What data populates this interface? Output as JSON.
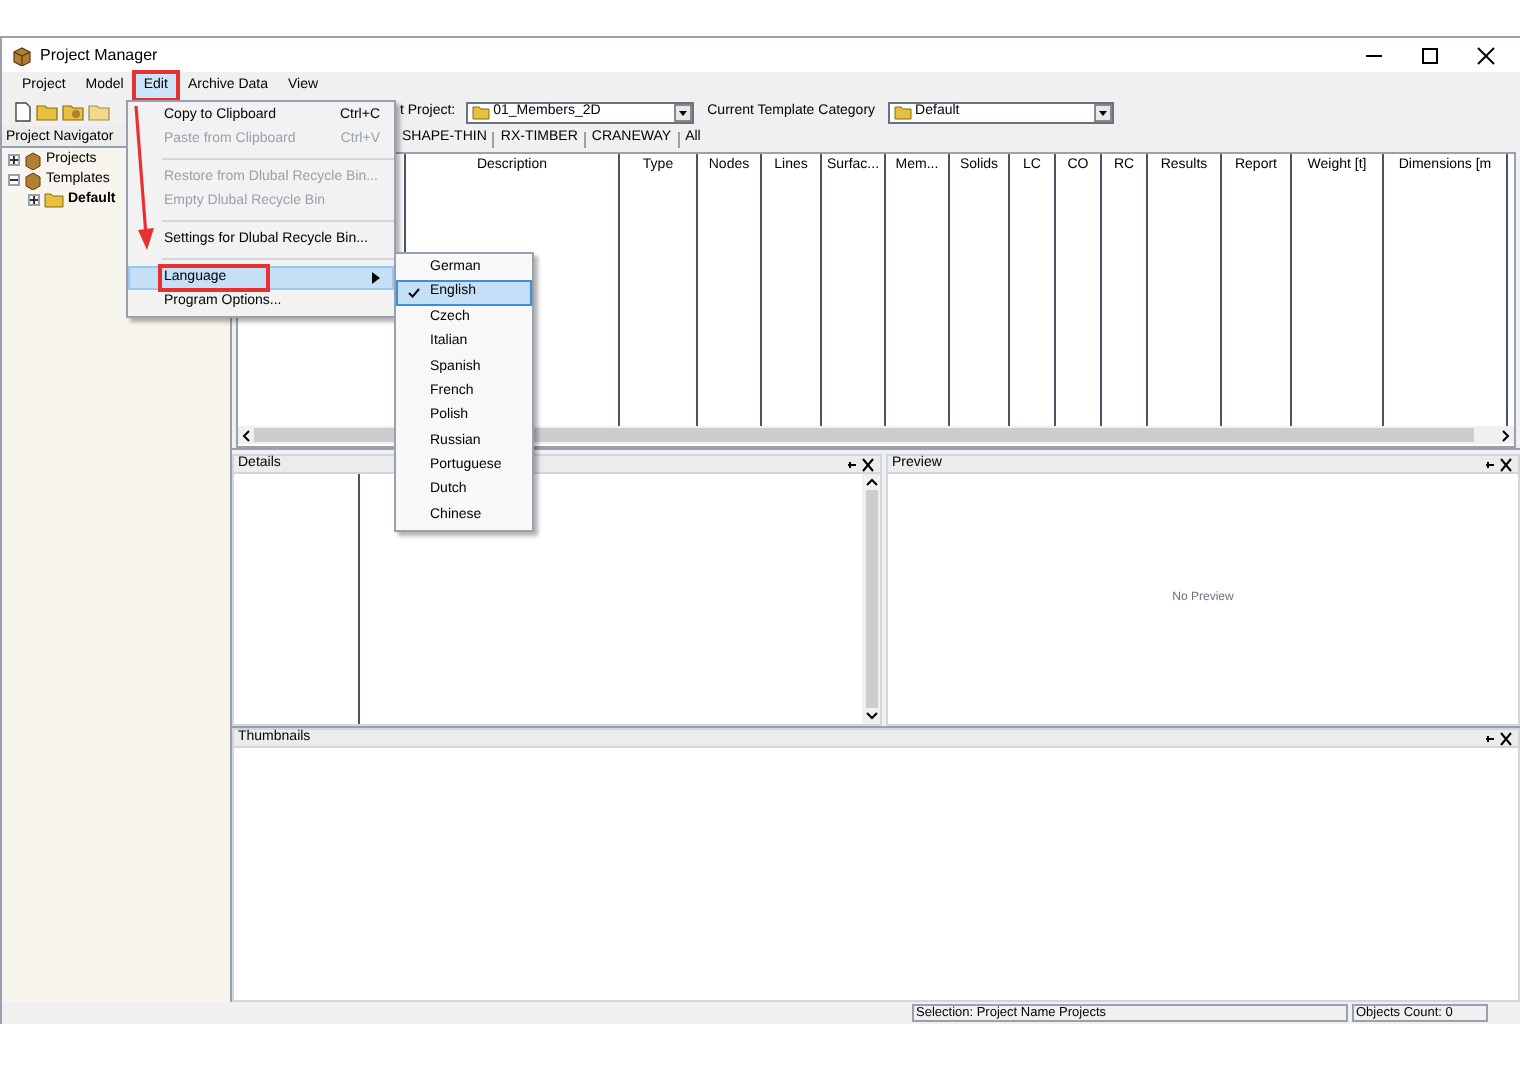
{
  "window": {
    "title": "Project Manager"
  },
  "menu_bar": [
    {
      "label": "Project",
      "selected": false,
      "annotated": false
    },
    {
      "label": "Model",
      "selected": false,
      "annotated": false
    },
    {
      "label": "Edit",
      "selected": true,
      "annotated": true
    },
    {
      "label": "Archive Data",
      "selected": false,
      "annotated": false
    },
    {
      "label": "View",
      "selected": false,
      "annotated": false
    }
  ],
  "toolbar": {
    "project_label": "t Project:",
    "project_value": "01_Members_2D",
    "category_label": "Current Template Category",
    "category_value": "Default"
  },
  "navigator": {
    "title": "Project Navigator",
    "tree": [
      {
        "label": "Projects",
        "expanded": false,
        "bold": false
      },
      {
        "label": "Templates",
        "expanded": true,
        "bold": false,
        "children": [
          {
            "label": "Default",
            "expanded": false,
            "bold": true
          }
        ]
      }
    ]
  },
  "tabs": [
    {
      "label": "SHAPE-THIN"
    },
    {
      "label": "RX-TIMBER"
    },
    {
      "label": "CRANEWAY"
    },
    {
      "label": "All"
    }
  ],
  "table": {
    "columns": [
      "Description",
      "Type",
      "Nodes",
      "Lines",
      "Surfac...",
      "Mem...",
      "Solids",
      "LC",
      "CO",
      "RC",
      "Results",
      "Report",
      "Weight [t]",
      "Dimensions [m"
    ]
  },
  "details": {
    "title": "Details"
  },
  "preview": {
    "title": "Preview",
    "message": "No Preview"
  },
  "thumbnails": {
    "title": "Thumbnails"
  },
  "status_bar": {
    "selection": "Selection: Project Name Projects",
    "count": "Objects Count: 0"
  },
  "edit_menu": [
    {
      "kind": "item",
      "label": "Copy to Clipboard",
      "shortcut": "Ctrl+C",
      "disabled": false,
      "selected": false,
      "submenu": false,
      "annotated": false
    },
    {
      "kind": "item",
      "label": "Paste from Clipboard",
      "shortcut": "Ctrl+V",
      "disabled": true,
      "selected": false,
      "submenu": false,
      "annotated": false
    },
    {
      "kind": "separator"
    },
    {
      "kind": "item",
      "label": "Restore from Dlubal Recycle Bin...",
      "disabled": true,
      "selected": false,
      "submenu": false,
      "annotated": false
    },
    {
      "kind": "item",
      "label": "Empty Dlubal Recycle Bin",
      "disabled": true,
      "selected": false,
      "submenu": false,
      "annotated": false
    },
    {
      "kind": "separator"
    },
    {
      "kind": "item",
      "label": "Settings for Dlubal Recycle Bin...",
      "disabled": false,
      "selected": false,
      "submenu": false,
      "annotated": false
    },
    {
      "kind": "separator"
    },
    {
      "kind": "item",
      "label": "Language",
      "disabled": false,
      "selected": true,
      "submenu": true,
      "annotated": true
    },
    {
      "kind": "item",
      "label": "Program Options...",
      "disabled": false,
      "selected": false,
      "submenu": false,
      "annotated": false
    }
  ],
  "language_menu": [
    {
      "label": "German",
      "checked": false,
      "selected": false
    },
    {
      "label": "English",
      "checked": true,
      "selected": true
    },
    {
      "label": "Czech",
      "checked": false,
      "selected": false
    },
    {
      "label": "Italian",
      "checked": false,
      "selected": false
    },
    {
      "label": "Spanish",
      "checked": false,
      "selected": false
    },
    {
      "label": "French",
      "checked": false,
      "selected": false
    },
    {
      "label": "Polish",
      "checked": false,
      "selected": false
    },
    {
      "label": "Russian",
      "checked": false,
      "selected": false
    },
    {
      "label": "Portuguese",
      "checked": false,
      "selected": false
    },
    {
      "label": "Dutch",
      "checked": false,
      "selected": false
    },
    {
      "label": "Chinese",
      "checked": false,
      "selected": false
    }
  ]
}
